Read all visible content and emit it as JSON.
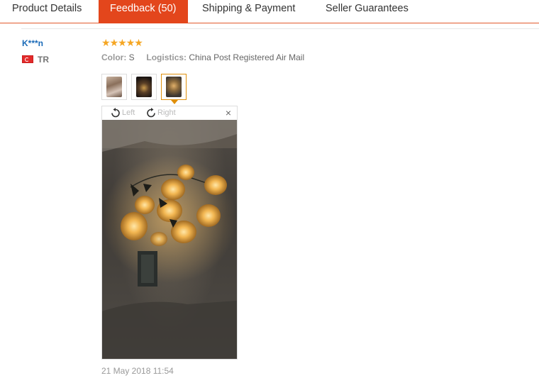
{
  "tabs": [
    {
      "label": "Product Details"
    },
    {
      "label": "Feedback (50)"
    },
    {
      "label": "Shipping & Payment"
    },
    {
      "label": "Seller Guarantees"
    }
  ],
  "review": {
    "user": "K***n",
    "country": "TR",
    "rating": 5,
    "color_label": "Color:",
    "color_value": "S",
    "logistics_label": "Logistics:",
    "logistics_value": "China Post Registered Air Mail",
    "thumbnails": [
      "photo-1",
      "photo-2",
      "photo-3"
    ],
    "selected_thumbnail": 3,
    "viewer": {
      "rotate_left": "Left",
      "rotate_right": "Right",
      "close": "×"
    },
    "date": "21 May 2018 11:54"
  },
  "colors": {
    "active_tab": "#e3461c",
    "user_link": "#1b6bb8",
    "stars": "#f5a623",
    "selected_thumb_border": "#e0900c"
  }
}
